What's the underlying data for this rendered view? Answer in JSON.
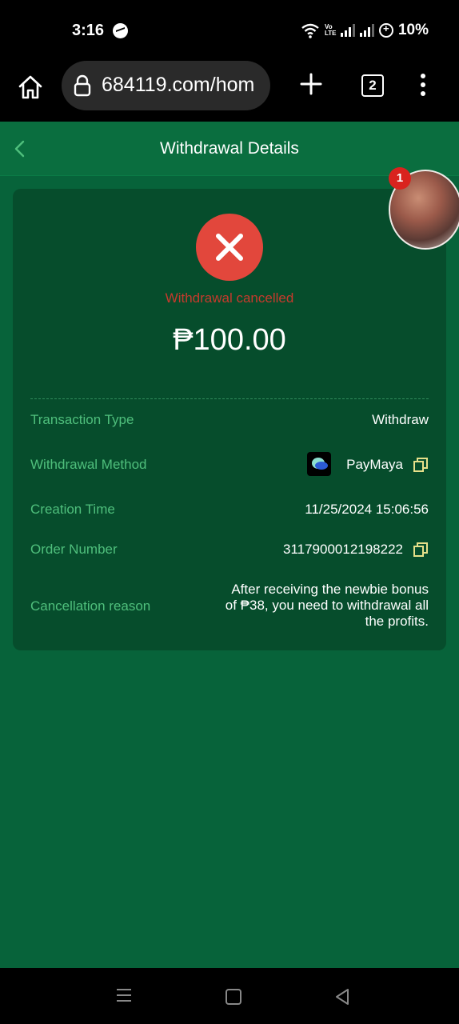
{
  "status_bar": {
    "time": "3:16",
    "network_label": "Vo LTE",
    "battery": "10%",
    "icons": [
      "messenger-icon",
      "wifi-icon",
      "signal-icon",
      "battery-saver-icon"
    ]
  },
  "browser": {
    "url": "684119.com/hom",
    "tab_count": "2",
    "icons": [
      "home-icon",
      "lock-icon",
      "plus-icon",
      "tabs-icon",
      "more-vert-icon"
    ]
  },
  "header": {
    "title": "Withdrawal Details"
  },
  "summary": {
    "status": "Withdrawal cancelled",
    "amount": "₱100.00",
    "status_color": "#e2473c"
  },
  "details": {
    "transaction_type_label": "Transaction Type",
    "transaction_type_value": "Withdraw",
    "method_label": "Withdrawal Method",
    "method_value": "PayMaya",
    "creation_time_label": "Creation Time",
    "creation_time_value": "11/25/2024 15:06:56",
    "order_number_label": "Order Number",
    "order_number_value": "3117900012198222",
    "cancellation_reason_label": "Cancellation reason",
    "cancellation_reason_value": "After receiving the newbie bonus of ₱38, you need to withdrawal all the profits."
  },
  "floating_avatar": {
    "badge": "1"
  },
  "colors": {
    "app_background": "#07633a",
    "card_background": "#064d2c",
    "label_green": "#4fbf7c",
    "copy_icon": "#e6e08a",
    "error_red": "#c63a2c"
  }
}
